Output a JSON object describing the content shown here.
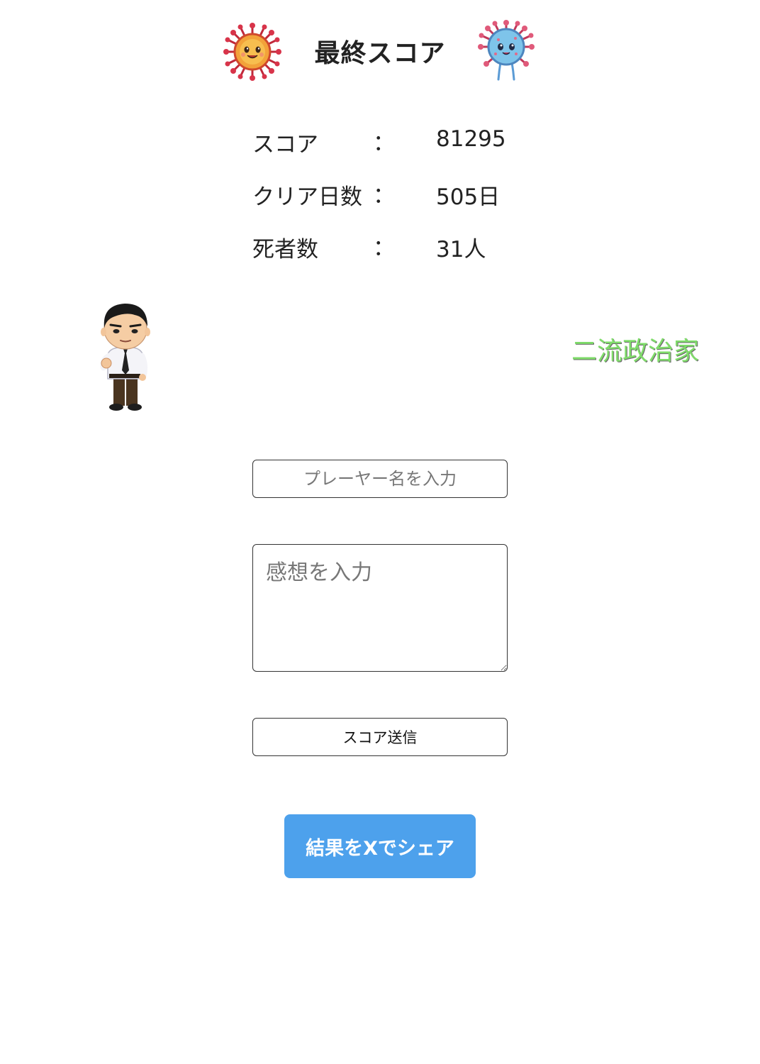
{
  "header": {
    "title": "最終スコア",
    "left_icon": "orange-virus-mascot-icon",
    "right_icon": "blue-virus-mascot-icon"
  },
  "stats": [
    {
      "label": "スコア",
      "colon": "：",
      "value": "81295"
    },
    {
      "label": "クリア日数",
      "colon": "：",
      "value": "505日"
    },
    {
      "label": "死者数",
      "colon": "：",
      "value": "31人"
    }
  ],
  "result": {
    "character_icon": "politician-character-icon",
    "rank": "二流政治家",
    "rank_color": "#7fdc6a"
  },
  "form": {
    "name_placeholder": "プレーヤー名を入力",
    "name_value": "",
    "comment_placeholder": "感想を入力",
    "comment_value": "",
    "submit_label": "スコア送信"
  },
  "share": {
    "label": "結果をXでシェア",
    "color": "#4da1ec"
  }
}
